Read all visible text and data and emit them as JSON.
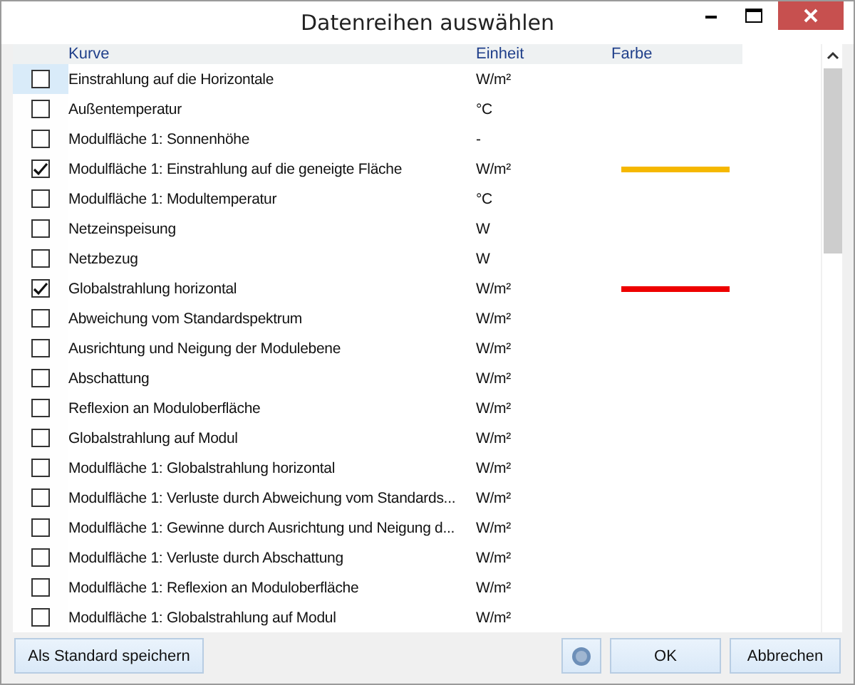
{
  "window": {
    "title": "Datenreihen auswählen"
  },
  "table": {
    "columns": [
      "Kurve",
      "Einheit",
      "Farbe"
    ],
    "rows": [
      {
        "name": "Einstrahlung auf die Horizontale",
        "unit": "W/m²",
        "checked": false,
        "selected": true
      },
      {
        "name": "Außentemperatur",
        "unit": "°C",
        "checked": false,
        "selected": false
      },
      {
        "name": "Modulfläche 1: Sonnenhöhe",
        "unit": "-",
        "checked": false,
        "selected": false
      },
      {
        "name": "Modulfläche 1: Einstrahlung auf die geneigte Fläche",
        "unit": "W/m²",
        "checked": true,
        "selected": false,
        "color": "#f5b800"
      },
      {
        "name": "Modulfläche 1: Modultemperatur",
        "unit": "°C",
        "checked": false,
        "selected": false
      },
      {
        "name": "Netzeinspeisung",
        "unit": "W",
        "checked": false,
        "selected": false
      },
      {
        "name": "Netzbezug",
        "unit": "W",
        "checked": false,
        "selected": false
      },
      {
        "name": "Globalstrahlung horizontal",
        "unit": "W/m²",
        "checked": true,
        "selected": false,
        "color": "#ee0000"
      },
      {
        "name": "Abweichung vom Standardspektrum",
        "unit": "W/m²",
        "checked": false,
        "selected": false
      },
      {
        "name": "Ausrichtung und Neigung der Modulebene",
        "unit": "W/m²",
        "checked": false,
        "selected": false
      },
      {
        "name": "Abschattung",
        "unit": "W/m²",
        "checked": false,
        "selected": false
      },
      {
        "name": "Reflexion an Moduloberfläche",
        "unit": "W/m²",
        "checked": false,
        "selected": false
      },
      {
        "name": "Globalstrahlung auf Modul",
        "unit": "W/m²",
        "checked": false,
        "selected": false
      },
      {
        "name": "Modulfläche 1: Globalstrahlung horizontal",
        "unit": "W/m²",
        "checked": false,
        "selected": false
      },
      {
        "name": "Modulfläche 1: Verluste durch Abweichung vom Standards...",
        "unit": "W/m²",
        "checked": false,
        "selected": false
      },
      {
        "name": "Modulfläche 1: Gewinne durch Ausrichtung und Neigung d...",
        "unit": "W/m²",
        "checked": false,
        "selected": false
      },
      {
        "name": "Modulfläche 1: Verluste durch Abschattung",
        "unit": "W/m²",
        "checked": false,
        "selected": false
      },
      {
        "name": "Modulfläche 1: Reflexion an Moduloberfläche",
        "unit": "W/m²",
        "checked": false,
        "selected": false
      },
      {
        "name": "Modulfläche 1: Globalstrahlung auf Modul",
        "unit": "W/m²",
        "checked": false,
        "selected": false
      }
    ]
  },
  "buttons": {
    "left": "Als Standard speichern",
    "ok": "OK",
    "cancel": "Abbrechen"
  }
}
